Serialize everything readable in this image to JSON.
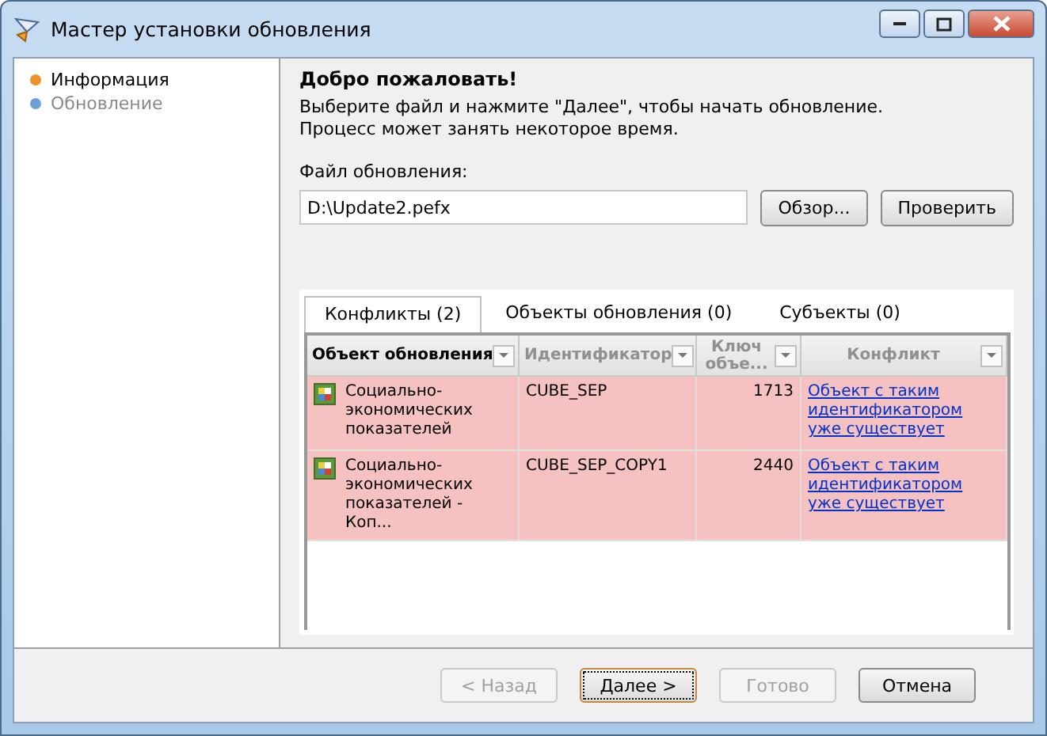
{
  "window": {
    "title": "Мастер установки обновления"
  },
  "steps": [
    {
      "label": "Информация",
      "selected": true
    },
    {
      "label": "Обновление",
      "selected": false
    }
  ],
  "heading": "Добро пожаловать!",
  "intro": [
    "Выберите файл и нажмите \"Далее\", чтобы начать обновление.",
    "Процесс может занять некоторое время."
  ],
  "file": {
    "label": "Файл обновления:",
    "value": "D:\\Update2.pefx"
  },
  "file_buttons": [
    "Обзор...",
    "Проверить"
  ],
  "tabs": [
    {
      "label": "Конфликты (2)",
      "selected": true
    },
    {
      "label": "Объекты обновления (0)",
      "selected": false
    },
    {
      "label": "Субъекты (0)",
      "selected": false
    }
  ],
  "table": {
    "columns": [
      {
        "label": "Объект обновления",
        "sorted": true
      },
      {
        "label": "Идентификатор",
        "sorted": false
      },
      {
        "label": "Ключ объе...",
        "sorted": false
      },
      {
        "label": "Конфликт",
        "sorted": false
      }
    ],
    "rows": [
      {
        "object": "Социально-экономических показателей",
        "id": "CUBE_SEP",
        "key": "1713",
        "conflict": "Объект с таким идентификатором уже существует"
      },
      {
        "object": "Социально-экономических показателей - Коп...",
        "id": "CUBE_SEP_COPY1",
        "key": "2440",
        "conflict": "Объект с таким идентификатором уже существует"
      }
    ]
  },
  "buttons": [
    {
      "label": "< Назад",
      "disabled": true,
      "default": false
    },
    {
      "label": "Далее >",
      "disabled": false,
      "default": true
    },
    {
      "label": "Готово",
      "disabled": true,
      "default": false
    },
    {
      "label": "Отмена",
      "disabled": false,
      "default": false
    }
  ]
}
